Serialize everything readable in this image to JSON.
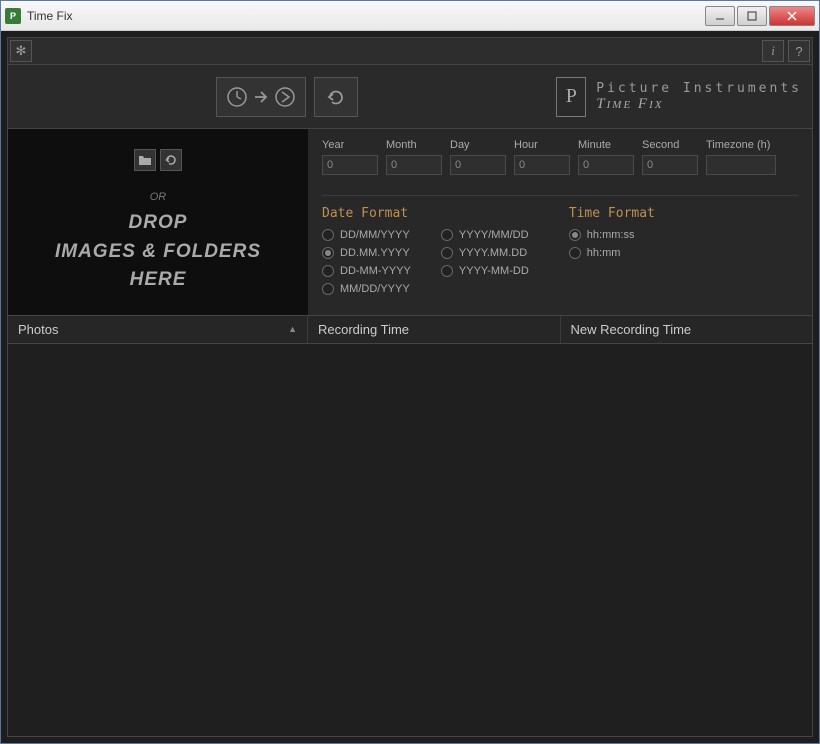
{
  "window": {
    "title": "Time Fix"
  },
  "brand": {
    "line1": "Picture Instruments",
    "line2": "Time Fix"
  },
  "drop": {
    "or": "OR",
    "l1": "DROP",
    "l2": "IMAGES & FOLDERS",
    "l3": "HERE"
  },
  "fields": {
    "year": {
      "label": "Year",
      "value": "0"
    },
    "month": {
      "label": "Month",
      "value": "0"
    },
    "day": {
      "label": "Day",
      "value": "0"
    },
    "hour": {
      "label": "Hour",
      "value": "0"
    },
    "minute": {
      "label": "Minute",
      "value": "0"
    },
    "second": {
      "label": "Second",
      "value": "0"
    },
    "timezone": {
      "label": "Timezone (h)",
      "value": ""
    }
  },
  "dateFormat": {
    "title": "Date Format",
    "options": {
      "o1": "DD/MM/YYYY",
      "o2": "DD.MM.YYYY",
      "o3": "DD-MM-YYYY",
      "o4": "MM/DD/YYYY",
      "o5": "YYYY/MM/DD",
      "o6": "YYYY.MM.DD",
      "o7": "YYYY-MM-DD"
    },
    "selected": "o2"
  },
  "timeFormat": {
    "title": "Time Format",
    "options": {
      "t1": "hh:mm:ss",
      "t2": "hh:mm"
    },
    "selected": "t1"
  },
  "table": {
    "col1": "Photos",
    "col2": "Recording Time",
    "col3": "New Recording Time"
  }
}
